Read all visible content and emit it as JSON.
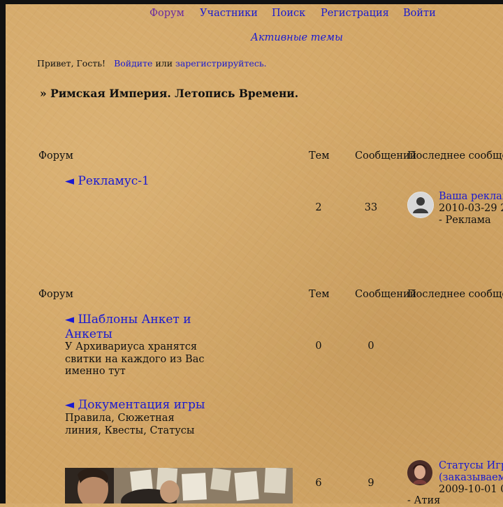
{
  "nav": {
    "forum": "Форум",
    "members": "Участники",
    "search": "Поиск",
    "register": "Регистрация",
    "login": "Войти",
    "active_topics": "Активные темы"
  },
  "welcome": {
    "greeting": "Привет, Гость!",
    "login_link": "Войдите",
    "or": "или",
    "register_link": "зарегистрируйтесь."
  },
  "breadcrumb": {
    "prefix": "»",
    "title": "Римская Империя. Летопись Времени."
  },
  "columns": {
    "forum": "Форум",
    "topics": "Тем",
    "posts": "Сообщений",
    "last_post": "Последнее сообщение"
  },
  "categories": [
    {
      "forums": [
        {
          "title": "◄ Рекламус-1",
          "topics": "2",
          "posts": "33",
          "last_post": {
            "title": "Ваша реклама",
            "date": "2010-03-29 2",
            "author": "- Реклама"
          }
        }
      ]
    },
    {
      "forums": [
        {
          "title": "◄ Шаблоны Анкет и Анкеты",
          "description": "У Архивариуса хранятся свитки на каждого из Вас именно тут",
          "topics": "0",
          "posts": "0"
        },
        {
          "title": "◄ Документация игры",
          "description": "Правила, Сюжетная линия, Квесты, Статусы"
        },
        {
          "topics": "6",
          "posts": "9",
          "last_post": {
            "title": "Статусы Игр",
            "subtitle": "(заказываем",
            "date": "2009-10-01 0",
            "author": "- Атия"
          }
        }
      ]
    }
  ]
}
